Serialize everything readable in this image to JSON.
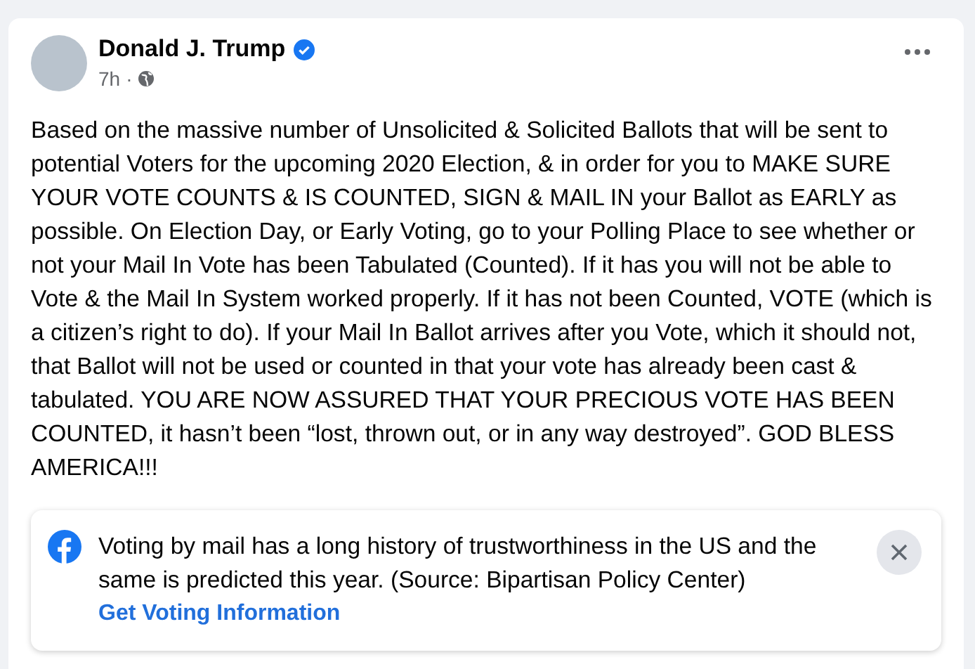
{
  "post": {
    "author": "Donald J. Trump",
    "verified": true,
    "time": "7h",
    "separator": "·",
    "body": "Based on the massive number of Unsolicited & Solicited Ballots that will be sent to potential Voters for the upcoming 2020 Election, & in order for you to MAKE SURE YOUR VOTE COUNTS & IS COUNTED, SIGN & MAIL IN your Ballot as EARLY as possible. On Election Day, or Early Voting, go to your Polling Place to see whether or not your Mail In Vote has been Tabulated (Counted). If it has you will not be able to Vote & the Mail In System worked properly. If it has not been Counted, VOTE (which is a citizen’s right to do). If your Mail In Ballot arrives after you Vote, which it should not, that Ballot will not be used or counted in that your vote has already been cast & tabulated. YOU ARE NOW ASSURED THAT YOUR PRECIOUS VOTE HAS BEEN COUNTED, it hasn’t been “lost, thrown out, or in any way destroyed”. GOD BLESS AMERICA!!!"
  },
  "notice": {
    "text": "Voting by mail has a long history of trustworthiness in the US and the same is predicted this year. (Source: Bipartisan Policy Center)",
    "link": "Get Voting Information"
  }
}
